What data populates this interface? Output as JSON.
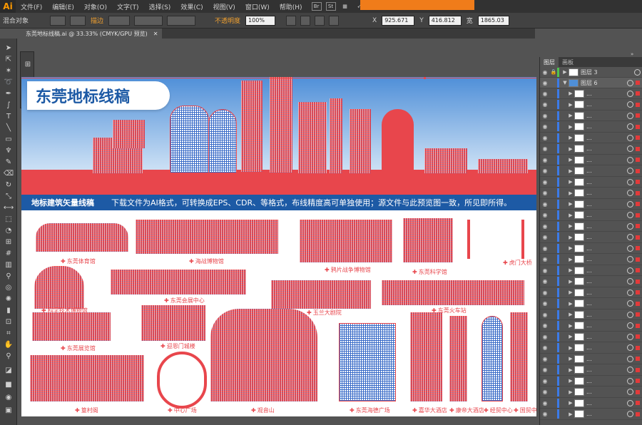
{
  "app": {
    "logo": "Ai"
  },
  "menu": [
    "文件(F)",
    "编辑(E)",
    "对象(O)",
    "文字(T)",
    "选择(S)",
    "效果(C)",
    "视图(V)",
    "窗口(W)",
    "帮助(H)"
  ],
  "menubar_icons": [
    "Br",
    "St"
  ],
  "control_bar": {
    "group_label": "混合对象",
    "stroke_label": "描边",
    "opacity_label": "不透明度",
    "opacity_value": "100%",
    "x_label": "X",
    "x_value": "925.671",
    "y_label": "Y",
    "y_value": "416.812",
    "w_label": "宽",
    "w_value": "1865.03"
  },
  "document_tab": {
    "title": "东莞地标线稿.ai @ 33.33% (CMYK/GPU 预览)"
  },
  "artboard": {
    "title": "东莞地标线稿",
    "banner_title": "地标建筑矢量线稿",
    "banner_text": "下载文件为AI格式，可转换成EPS、CDR、等格式，布线精度高可单独使用；源文件与此预览图一致，所见即所得。",
    "landmarks": [
      "东莞体育馆",
      "海战博物馆",
      "鸦片战争博物馆",
      "东莞科学馆",
      "虎门大桥",
      "科学技术博物馆",
      "东莞会展中心",
      "玉兰大剧院",
      "东莞火车站",
      "东莞展览馆",
      "迎恩门城楼",
      "篁村阁",
      "中心广场",
      "观音山",
      "东莞海德广场",
      "嘉华大酒店",
      "康帝大酒店",
      "经贸中心",
      "国贸中心"
    ]
  },
  "layers_panel": {
    "tabs": [
      "图层",
      "画板"
    ],
    "layers": [
      {
        "name": "图层 3",
        "color": "#4fc34f"
      },
      {
        "name": "图层 6",
        "color": "#3b7be8"
      }
    ],
    "sublayer_name": "...",
    "sublayer_count": 30
  },
  "colors": {
    "accent_red": "#e8464c",
    "banner_blue": "#1d5aa5",
    "ui_dark": "#323232",
    "ui_mid": "#424242",
    "selection_red": "#e23a3a"
  }
}
